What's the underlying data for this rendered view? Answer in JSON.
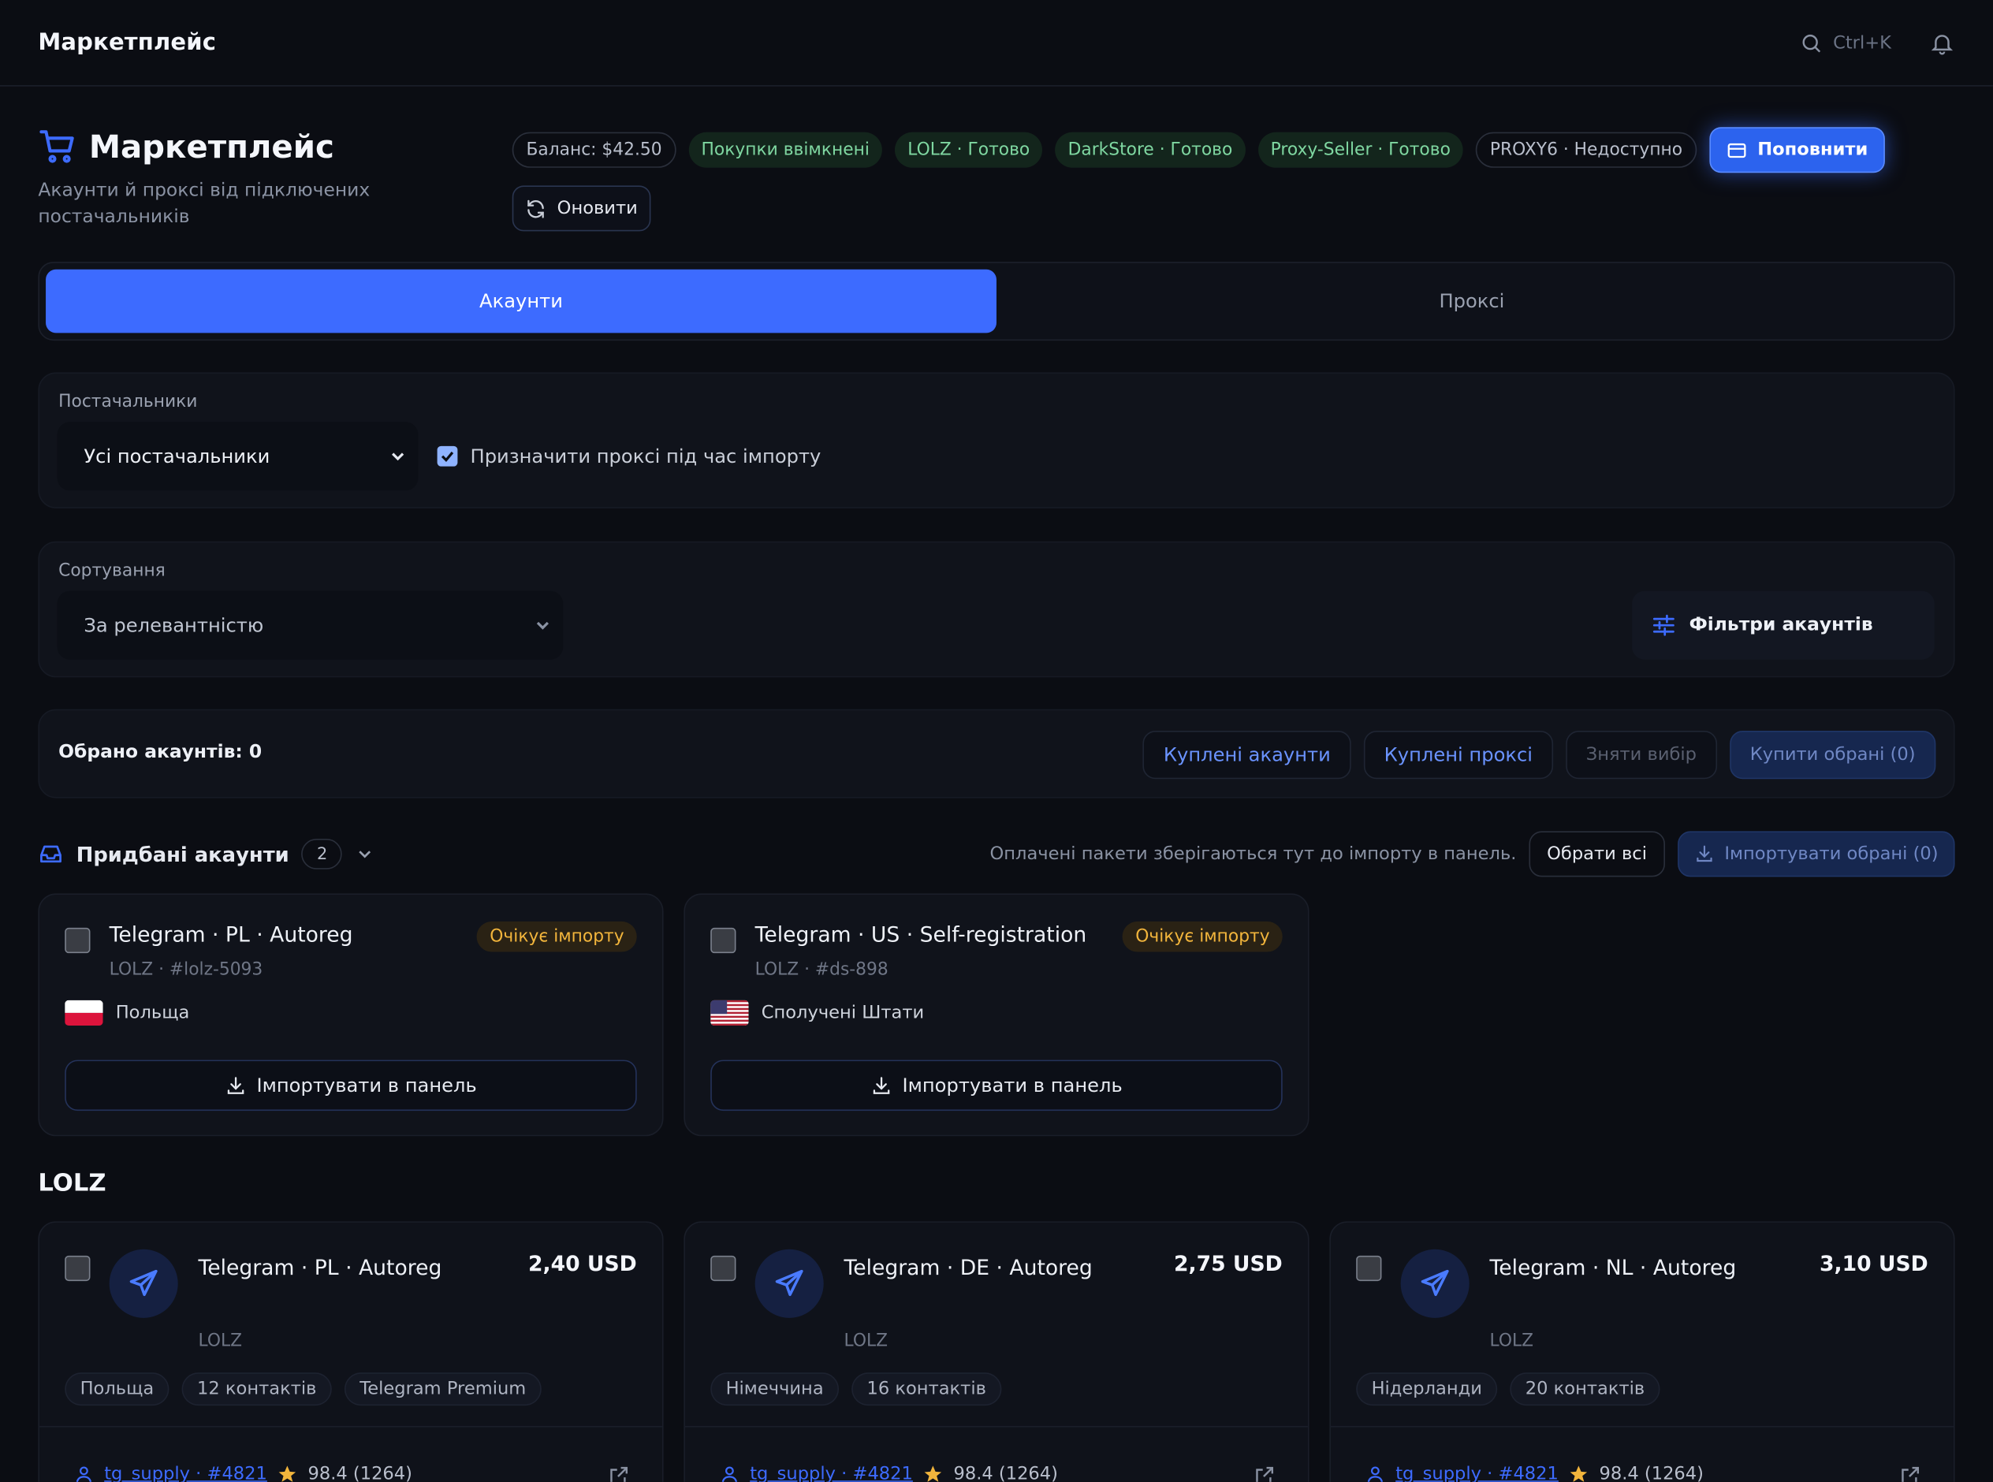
{
  "app": {
    "brand": "Маркетплейс",
    "search_hint": "Ctrl+K"
  },
  "header": {
    "title": "Маркетплейс",
    "subtitle": "Акаунти й проксі від підключених постачальників",
    "badges": [
      {
        "label": "Баланс: $42.50",
        "style": "outline"
      },
      {
        "label": "Покупки ввімкнені",
        "style": "green"
      },
      {
        "label": "LOLZ · Готово",
        "style": "green"
      },
      {
        "label": "DarkStore · Готово",
        "style": "green"
      },
      {
        "label": "Proxy-Seller · Готово",
        "style": "green"
      },
      {
        "label": "PROXY6 · Недоступно",
        "style": "outline"
      }
    ],
    "topup_label": "Поповнити",
    "refresh_label": "Оновити"
  },
  "tabs": [
    {
      "label": "Акаунти",
      "active": true
    },
    {
      "label": "Проксі",
      "active": false
    }
  ],
  "suppliers": {
    "label": "Постачальники",
    "selected": "Усі постачальники",
    "assign_proxy_label": "Призначити проксі під час імпорту",
    "assign_proxy_checked": true
  },
  "sorting": {
    "label": "Сортування",
    "selected": "За релевантністю",
    "filters_label": "Фільтри акаунтів"
  },
  "selection": {
    "count_label": "Обрано акаунтів: 0",
    "bought_accounts": "Куплені акаунти",
    "bought_proxies": "Куплені проксі",
    "clear": "Зняти вибір",
    "buy_selected": "Купити обрані (0)"
  },
  "purchased": {
    "title": "Придбані акаунти",
    "count": "2",
    "note": "Оплачені пакети зберігаються тут до імпорту в панель.",
    "select_all": "Обрати всі",
    "import_selected": "Імпортувати обрані (0)",
    "items": [
      {
        "title": "Telegram · PL · Autoreg",
        "sub": "LOLZ · #lolz-5093",
        "status": "Очікує імпорту",
        "country": "Польща",
        "flag": "pl",
        "import_label": "Імпортувати в панель"
      },
      {
        "title": "Telegram · US · Self-registration",
        "sub": "LOLZ · #ds-898",
        "status": "Очікує імпорту",
        "country": "Сполучені Штати",
        "flag": "us",
        "import_label": "Імпортувати в панель"
      }
    ]
  },
  "section": {
    "title": "LOLZ"
  },
  "products": [
    {
      "title": "Telegram · PL · Autoreg",
      "price": "2,40 USD",
      "provider": "LOLZ",
      "tags": [
        "Польща",
        "12 контактів",
        "Telegram Premium"
      ],
      "seller": "tg_supply · #4821",
      "rating": "98.4 (1264)"
    },
    {
      "title": "Telegram · DE · Autoreg",
      "price": "2,75 USD",
      "provider": "LOLZ",
      "tags": [
        "Німеччина",
        "16 контактів"
      ],
      "seller": "tg_supply · #4821",
      "rating": "98.4 (1264)"
    },
    {
      "title": "Telegram · NL · Autoreg",
      "price": "3,10 USD",
      "provider": "LOLZ",
      "tags": [
        "Нідерланди",
        "20 контактів"
      ],
      "seller": "tg_supply · #4821",
      "rating": "98.4 (1264)"
    }
  ],
  "colors": {
    "accent": "#3d6bff",
    "background": "#0b0d13",
    "ready": "#7fd7a1",
    "pending": "#f2b53c"
  }
}
